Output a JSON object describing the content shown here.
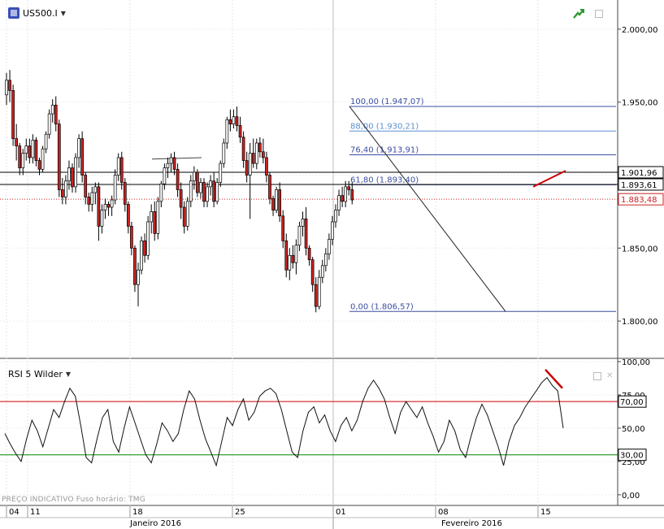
{
  "symbol": "US500.I",
  "indicator_title": "RSI 5 Wilder",
  "footer_note": "PREÇO INDICATIVO   Fuso horário: TMG",
  "colors": {
    "up": "#ffffff",
    "down": "#cc2222",
    "wick": "#000000",
    "fib": "#3b4ea0",
    "fib_label": "#3b4ea0",
    "red_line": "#cc0000",
    "green_line": "#008800"
  },
  "chart_data": [
    {
      "type": "candlestick",
      "y_range": [
        1775,
        2020
      ],
      "y_ticks": [
        "2.000,00",
        "1.950,00",
        "1.900,00",
        "1.850,00",
        "1.800,00"
      ],
      "y_tick_values": [
        2000,
        1950,
        1900,
        1850,
        1800
      ],
      "price_tags": [
        {
          "label": "1.901,96",
          "value": 1901.96,
          "style": "black"
        },
        {
          "label": "1.893,61",
          "value": 1893.61,
          "style": "black"
        },
        {
          "label": "1.883,48",
          "value": 1883.48,
          "style": "red"
        }
      ],
      "fib_levels": [
        {
          "label": "100,00 (1.947,07)",
          "value": 1947.07,
          "color": "#3b4ea0"
        },
        {
          "label": "88,00 (1.930,21)",
          "value": 1930.21,
          "color": "#5b8fd0"
        },
        {
          "label": "76,40 (1.913,91)",
          "value": 1913.91,
          "color": "#3b4ea0"
        },
        {
          "label": "61,80 (1.893,40)",
          "value": 1893.4,
          "color": "#3b4ea0"
        },
        {
          "label": "0,00 (1.806,57)",
          "value": 1806.57,
          "color": "#3b4ea0"
        }
      ],
      "x_ticks": [
        "04",
        "11",
        "18",
        "25",
        "01",
        "08",
        "15"
      ],
      "x_months": [
        "Janeiro 2016",
        "Fevereiro 2016"
      ],
      "candles": [
        [
          1955,
          1970,
          1948,
          1965
        ],
        [
          1965,
          1972,
          1950,
          1958
        ],
        [
          1958,
          1962,
          1920,
          1925
        ],
        [
          1925,
          1935,
          1910,
          1920
        ],
        [
          1920,
          1922,
          1900,
          1905
        ],
        [
          1905,
          1918,
          1900,
          1915
        ],
        [
          1915,
          1925,
          1910,
          1920
        ],
        [
          1920,
          1925,
          1908,
          1912
        ],
        [
          1912,
          1928,
          1908,
          1924
        ],
        [
          1924,
          1926,
          1906,
          1910
        ],
        [
          1910,
          1912,
          1900,
          1904
        ],
        [
          1904,
          1920,
          1902,
          1918
        ],
        [
          1918,
          1930,
          1915,
          1928
        ],
        [
          1928,
          1945,
          1925,
          1942
        ],
        [
          1942,
          1952,
          1936,
          1948
        ],
        [
          1948,
          1954,
          1930,
          1935
        ],
        [
          1935,
          1938,
          1885,
          1890
        ],
        [
          1890,
          1898,
          1880,
          1885
        ],
        [
          1885,
          1900,
          1880,
          1896
        ],
        [
          1896,
          1910,
          1890,
          1905
        ],
        [
          1905,
          1908,
          1888,
          1892
        ],
        [
          1892,
          1915,
          1888,
          1912
        ],
        [
          1912,
          1928,
          1905,
          1925
        ],
        [
          1925,
          1930,
          1895,
          1900
        ],
        [
          1900,
          1902,
          1880,
          1885
        ],
        [
          1885,
          1888,
          1875,
          1880
        ],
        [
          1880,
          1892,
          1875,
          1888
        ],
        [
          1888,
          1895,
          1880,
          1892
        ],
        [
          1892,
          1895,
          1855,
          1865
        ],
        [
          1865,
          1880,
          1860,
          1876
        ],
        [
          1876,
          1884,
          1870,
          1880
        ],
        [
          1880,
          1882,
          1872,
          1878
        ],
        [
          1878,
          1886,
          1872,
          1883
        ],
        [
          1883,
          1904,
          1880,
          1900
        ],
        [
          1900,
          1915,
          1896,
          1912
        ],
        [
          1912,
          1916,
          1890,
          1895
        ],
        [
          1895,
          1898,
          1875,
          1880
        ],
        [
          1880,
          1882,
          1860,
          1865
        ],
        [
          1865,
          1868,
          1845,
          1850
        ],
        [
          1850,
          1852,
          1820,
          1825
        ],
        [
          1825,
          1840,
          1810,
          1835
        ],
        [
          1835,
          1858,
          1832,
          1855
        ],
        [
          1855,
          1860,
          1840,
          1845
        ],
        [
          1845,
          1872,
          1842,
          1868
        ],
        [
          1868,
          1880,
          1860,
          1875
        ],
        [
          1875,
          1882,
          1855,
          1860
        ],
        [
          1860,
          1885,
          1856,
          1882
        ],
        [
          1882,
          1896,
          1878,
          1894
        ],
        [
          1894,
          1908,
          1890,
          1905
        ],
        [
          1905,
          1912,
          1898,
          1908
        ],
        [
          1908,
          1915,
          1902,
          1912
        ],
        [
          1912,
          1916,
          1900,
          1904
        ],
        [
          1904,
          1908,
          1885,
          1890
        ],
        [
          1890,
          1895,
          1870,
          1878
        ],
        [
          1878,
          1882,
          1860,
          1865
        ],
        [
          1865,
          1885,
          1862,
          1882
        ],
        [
          1882,
          1900,
          1878,
          1896
        ],
        [
          1896,
          1906,
          1890,
          1902
        ],
        [
          1902,
          1904,
          1885,
          1888
        ],
        [
          1888,
          1898,
          1884,
          1895
        ],
        [
          1895,
          1898,
          1878,
          1882
        ],
        [
          1882,
          1895,
          1878,
          1892
        ],
        [
          1892,
          1900,
          1886,
          1896
        ],
        [
          1896,
          1902,
          1878,
          1882
        ],
        [
          1882,
          1898,
          1880,
          1895
        ],
        [
          1895,
          1910,
          1892,
          1908
        ],
        [
          1908,
          1925,
          1905,
          1922
        ],
        [
          1922,
          1940,
          1918,
          1938
        ],
        [
          1938,
          1945,
          1930,
          1935
        ],
        [
          1935,
          1945,
          1932,
          1940
        ],
        [
          1940,
          1947,
          1930,
          1934
        ],
        [
          1934,
          1940,
          1922,
          1926
        ],
        [
          1926,
          1930,
          1905,
          1910
        ],
        [
          1910,
          1916,
          1895,
          1900
        ],
        [
          1900,
          1922,
          1870,
          1915
        ],
        [
          1915,
          1925,
          1905,
          1908
        ],
        [
          1908,
          1925,
          1904,
          1922
        ],
        [
          1922,
          1926,
          1912,
          1916
        ],
        [
          1916,
          1925,
          1908,
          1912
        ],
        [
          1912,
          1916,
          1895,
          1900
        ],
        [
          1900,
          1902,
          1880,
          1884
        ],
        [
          1884,
          1886,
          1872,
          1876
        ],
        [
          1876,
          1892,
          1874,
          1890
        ],
        [
          1890,
          1895,
          1868,
          1872
        ],
        [
          1872,
          1876,
          1850,
          1855
        ],
        [
          1855,
          1860,
          1830,
          1835
        ],
        [
          1835,
          1850,
          1828,
          1845
        ],
        [
          1845,
          1852,
          1836,
          1840
        ],
        [
          1840,
          1856,
          1832,
          1852
        ],
        [
          1852,
          1868,
          1848,
          1865
        ],
        [
          1865,
          1875,
          1858,
          1870
        ],
        [
          1870,
          1878,
          1845,
          1850
        ],
        [
          1850,
          1852,
          1838,
          1842
        ],
        [
          1842,
          1844,
          1820,
          1825
        ],
        [
          1825,
          1830,
          1806,
          1810
        ],
        [
          1810,
          1835,
          1808,
          1830
        ],
        [
          1830,
          1842,
          1826,
          1838
        ],
        [
          1838,
          1850,
          1834,
          1846
        ],
        [
          1846,
          1860,
          1842,
          1856
        ],
        [
          1856,
          1872,
          1852,
          1868
        ],
        [
          1868,
          1880,
          1864,
          1876
        ],
        [
          1876,
          1890,
          1872,
          1886
        ],
        [
          1886,
          1892,
          1878,
          1882
        ],
        [
          1882,
          1896,
          1878,
          1892
        ],
        [
          1892,
          1896,
          1886,
          1890
        ],
        [
          1890,
          1895,
          1880,
          1883
        ]
      ]
    },
    {
      "type": "line",
      "name": "RSI 5 Wilder",
      "y_range": [
        -8,
        100
      ],
      "y_ticks": [
        "100,00",
        "75,00",
        "50,00",
        "25,00",
        "0,00"
      ],
      "y_tick_values": [
        100,
        75,
        50,
        25,
        0
      ],
      "levels": [
        {
          "label": "70,00",
          "value": 70,
          "color": "#cc0000"
        },
        {
          "label": "30,00",
          "value": 30,
          "color": "#008800"
        }
      ],
      "values": [
        46,
        38,
        31,
        25,
        42,
        56,
        48,
        36,
        50,
        64,
        58,
        70,
        80,
        74,
        52,
        28,
        24,
        42,
        58,
        64,
        40,
        32,
        50,
        66,
        54,
        42,
        30,
        24,
        38,
        54,
        48,
        40,
        46,
        64,
        78,
        72,
        56,
        42,
        32,
        22,
        40,
        58,
        52,
        64,
        72,
        56,
        62,
        74,
        78,
        80,
        76,
        64,
        48,
        32,
        28,
        48,
        62,
        66,
        54,
        60,
        48,
        40,
        52,
        58,
        48,
        56,
        70,
        80,
        86,
        80,
        72,
        58,
        46,
        62,
        70,
        64,
        58,
        66,
        54,
        44,
        32,
        40,
        56,
        48,
        34,
        28,
        44,
        58,
        68,
        60,
        48,
        36,
        22,
        40,
        52,
        58,
        66,
        72,
        78,
        84,
        88,
        82,
        78,
        50
      ]
    }
  ]
}
